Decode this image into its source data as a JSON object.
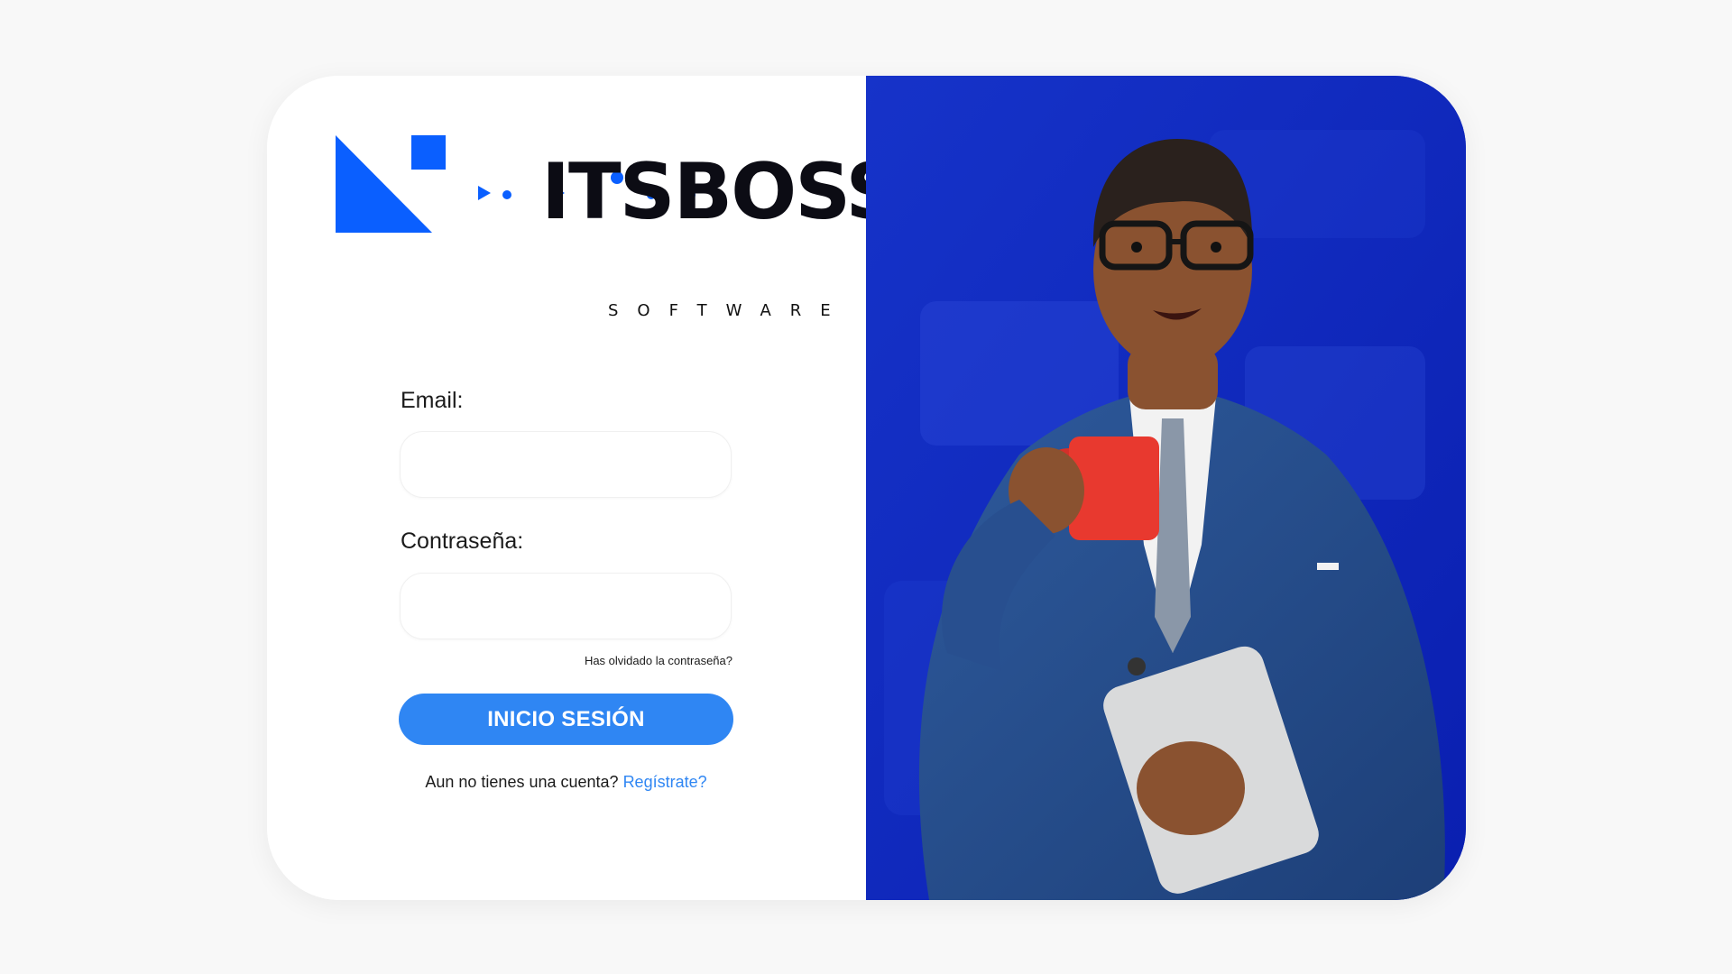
{
  "brand": {
    "wordmark": "ITSBOSS",
    "tagline": "SOFTWARE",
    "colors": {
      "primary_blue": "#0a5fff",
      "dark_text": "#0c0c14"
    }
  },
  "form": {
    "email_label": "Email:",
    "email_value": "",
    "email_placeholder": "",
    "password_label": "Contraseña:",
    "password_value": "",
    "password_placeholder": "",
    "forgot_password": "Has olvidado la contraseña?",
    "submit_label": "INICIO SESIÓN",
    "no_account_text": "Aun no tienes una cuenta?",
    "register_link": "Regístrate?"
  },
  "hero": {
    "image": "3d-businessman-with-mug-and-tablet",
    "background_color": "#0a23b8"
  },
  "colors": {
    "button": "#2f86f3",
    "link": "#2f86f3",
    "page_bg": "#f8f8f8"
  }
}
